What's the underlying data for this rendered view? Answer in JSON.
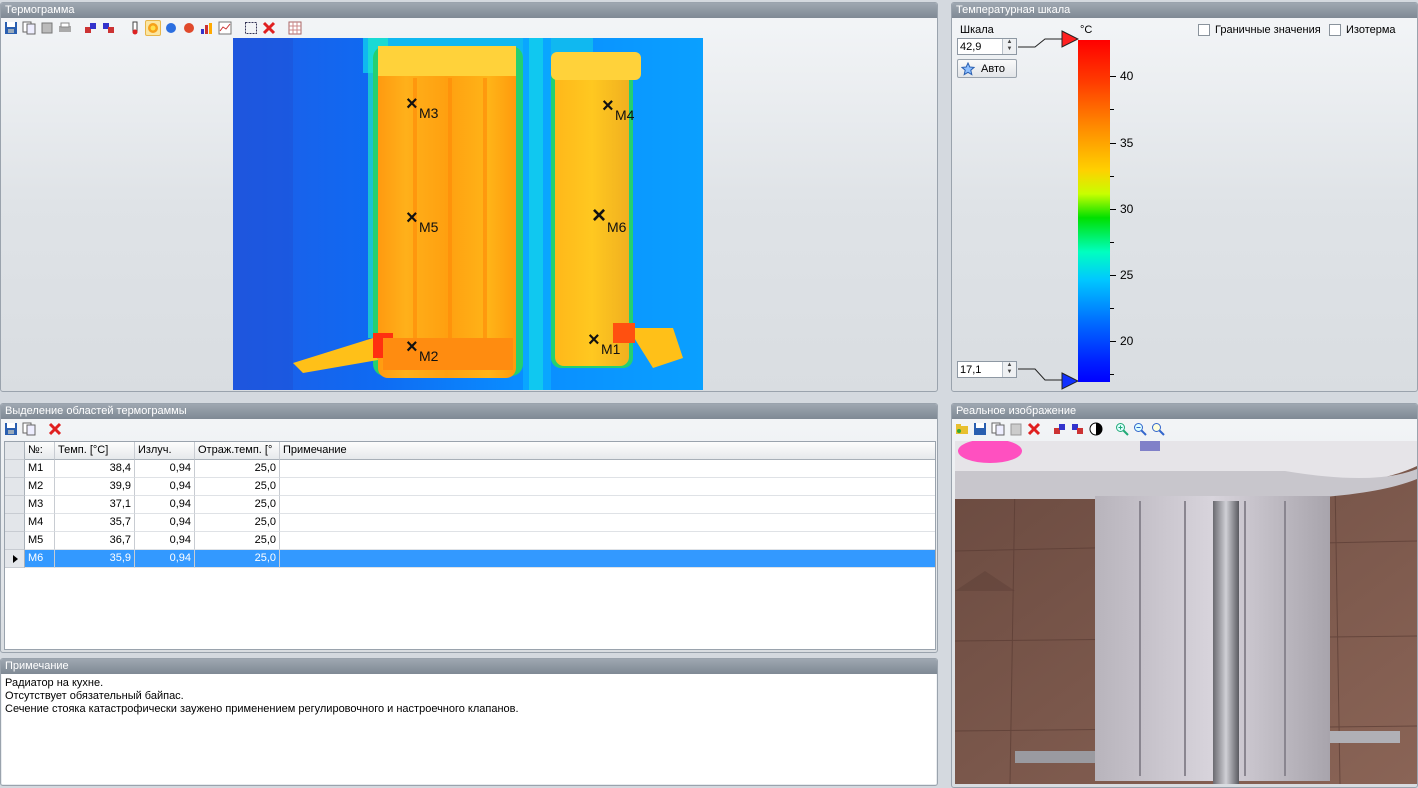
{
  "thermogram": {
    "title": "Термограмма",
    "toolbar": [
      "save-icon",
      "copy-icon",
      "export-icon",
      "print-icon",
      "rotate-icon",
      "flip-icon",
      "thermometer-icon",
      "spot-icon",
      "circle-blue-icon",
      "circle-red-icon",
      "histogram-icon",
      "profile-icon",
      "select-area-icon",
      "delete-icon",
      "grid-icon"
    ],
    "markers": [
      {
        "label": "М1"
      },
      {
        "label": "М2"
      },
      {
        "label": "М3"
      },
      {
        "label": "М4"
      },
      {
        "label": "М5"
      },
      {
        "label": "М6"
      }
    ]
  },
  "scale": {
    "title": "Температурная шкала",
    "scale_label": "Шкала",
    "max_value": "42,9",
    "min_value": "17,1",
    "auto_label": "Авто",
    "unit": "°C",
    "boundary_label": "Граничные значения",
    "isotherm_label": "Изотерма",
    "ticks": [
      "40",
      "35",
      "30",
      "25",
      "20"
    ],
    "max_color": "#ff0000",
    "min_color": "#0000ff"
  },
  "regions": {
    "title": "Выделение областей термограммы",
    "columns": [
      "№:",
      "Темп. [°C]",
      "Излуч.",
      "Отраж.темп. [°",
      "Примечание"
    ],
    "rows": [
      {
        "n": "М1",
        "temp": "38,4",
        "emis": "0,94",
        "refl": "25,0",
        "note": ""
      },
      {
        "n": "М2",
        "temp": "39,9",
        "emis": "0,94",
        "refl": "25,0",
        "note": ""
      },
      {
        "n": "М3",
        "temp": "37,1",
        "emis": "0,94",
        "refl": "25,0",
        "note": ""
      },
      {
        "n": "М4",
        "temp": "35,7",
        "emis": "0,94",
        "refl": "25,0",
        "note": ""
      },
      {
        "n": "М5",
        "temp": "36,7",
        "emis": "0,94",
        "refl": "25,0",
        "note": ""
      },
      {
        "n": "М6",
        "temp": "35,9",
        "emis": "0,94",
        "refl": "25,0",
        "note": ""
      }
    ],
    "selected_row": "М6"
  },
  "note": {
    "title": "Примечание",
    "lines": [
      "Радиатор на кухне.",
      "Отсутствует обязательный байпас.",
      "Сечение стояка катастрофически заужено применением регулировочного и настроечного клапанов."
    ]
  },
  "photo": {
    "title": "Реальное изображение"
  }
}
